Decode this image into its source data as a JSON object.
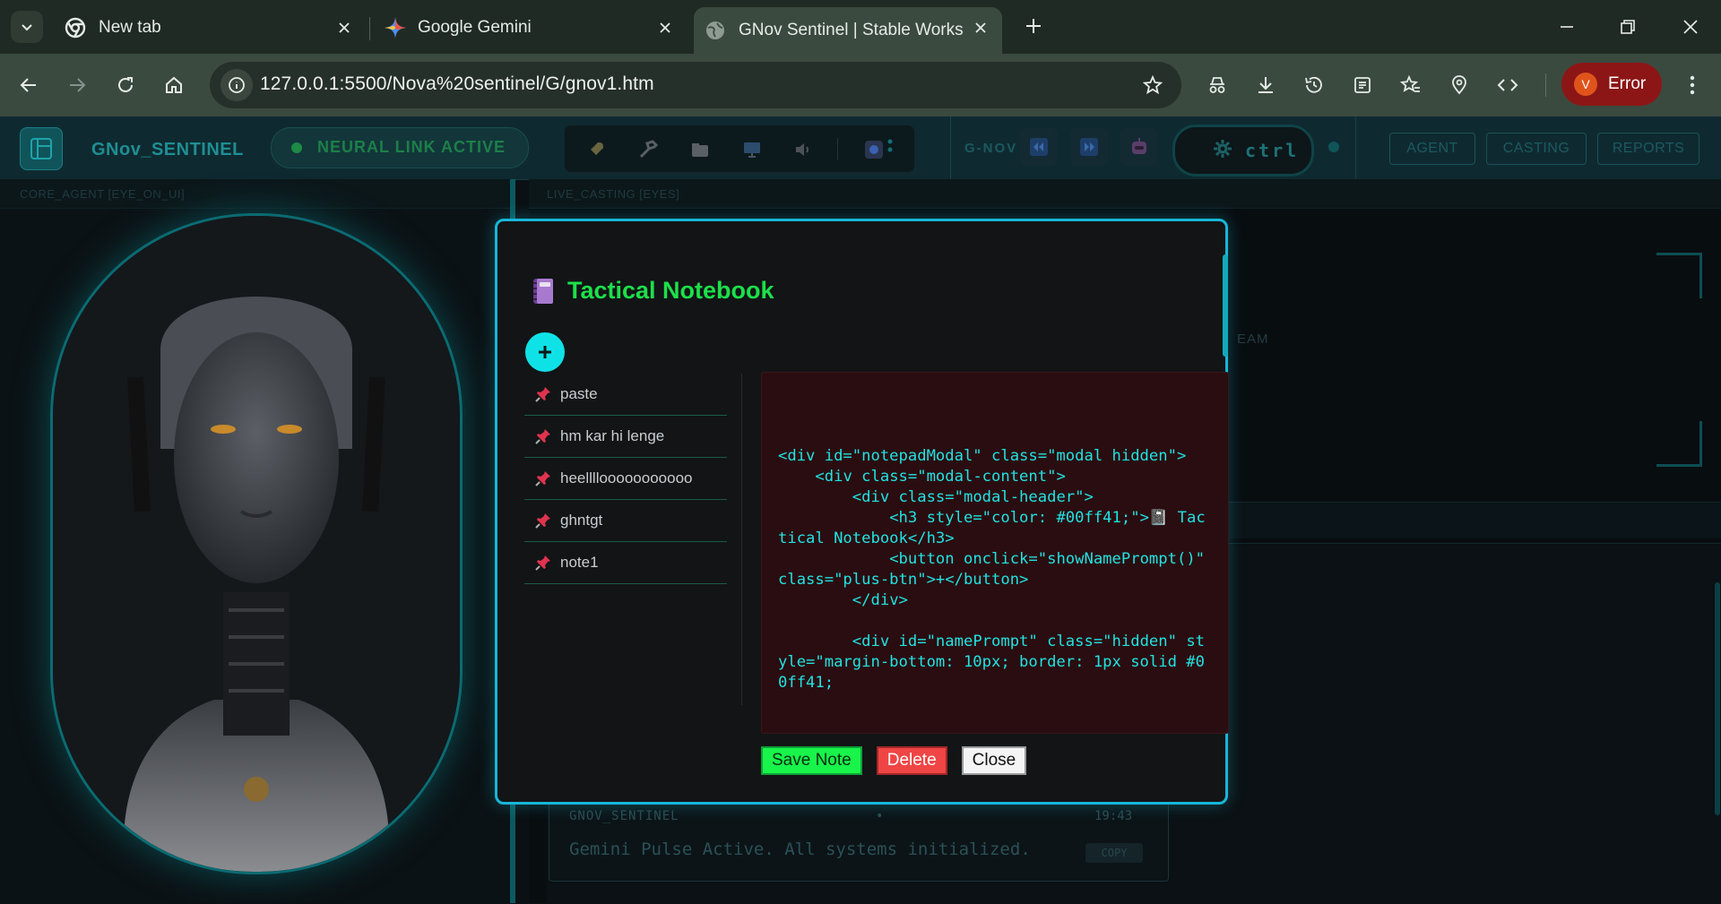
{
  "browser": {
    "tabs": [
      {
        "title": "New tab",
        "icon": "chrome-icon"
      },
      {
        "title": "Google Gemini",
        "icon": "gemini-sparkle-icon"
      },
      {
        "title": "GNov Sentinel | Stable Workspa",
        "icon": "globe-icon",
        "active": true
      }
    ],
    "url": "127.0.0.1:5500/Nova%20sentinel/G/gnov1.htm",
    "profile": {
      "initial": "V",
      "status": "Error",
      "color": "#8c1616"
    }
  },
  "app": {
    "title": "GNov_SENTINEL",
    "status": "NEURAL LINK ACTIVE",
    "gnov_label": "G-NOV",
    "ctrl_label": "ctrl",
    "nav": [
      "AGENT",
      "CASTING",
      "REPORTS"
    ],
    "left_panel_label": "CORE_AGENT [EYE_ON_UI]",
    "right_panel_label": "LIVE_CASTING [EYES]",
    "dream_fragment": "EAM",
    "message": {
      "author": "GNOV_SENTINEL",
      "separator": "•",
      "time": "19:43",
      "text": "Gemini Pulse Active. All systems initialized.",
      "copy_label": "COPY"
    }
  },
  "modal": {
    "icon": "notebook-icon",
    "title": "Tactical Notebook",
    "title_color": "#1ce04a",
    "add_label": "+",
    "notes": [
      "paste",
      "hm kar hi lenge",
      "heellllooooooooooo",
      "ghntgt",
      "note1"
    ],
    "editor_content": "<div id=\"notepadModal\" class=\"modal hidden\">\n    <div class=\"modal-content\">\n        <div class=\"modal-header\">\n            <h3 style=\"color: #00ff41;\">📓 Tactical Notebook</h3>\n            <button onclick=\"showNamePrompt()\" class=\"plus-btn\">+</button>\n        </div>\n\n        <div id=\"namePrompt\" class=\"hidden\" style=\"margin-bottom: 10px; border: 1px solid #00ff41;",
    "buttons": {
      "save": "Save Note",
      "delete": "Delete",
      "close": "Close"
    },
    "accent": "#18b6d8"
  }
}
